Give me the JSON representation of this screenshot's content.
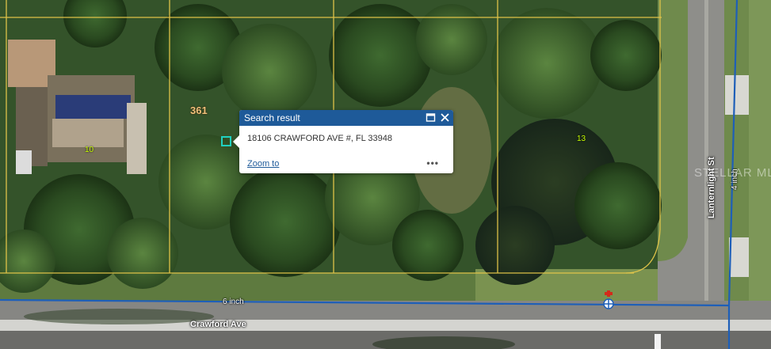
{
  "map": {
    "parcel_labels": {
      "p10": "10",
      "p13": "13",
      "p361": "361"
    },
    "pipe_label": "6 inch",
    "pipe_label_vertical": "4 inch",
    "street_horizontal": "Crawford Ave",
    "street_vertical": "Lanternlight St",
    "watermark": "STELLAR MLS",
    "colors": {
      "parcel_line": "#e8c84a",
      "water_main": "#1e5fb8",
      "highlight": "#20d0c0",
      "popup_header": "#1e5a99"
    }
  },
  "popup": {
    "title": "Search result",
    "address": "18106 CRAWFORD AVE #, FL 33948",
    "zoom_label": "Zoom to",
    "more_label": "•••",
    "icons": {
      "maximize": "maximize-icon",
      "close": "close-icon",
      "more": "more-options-icon"
    }
  }
}
